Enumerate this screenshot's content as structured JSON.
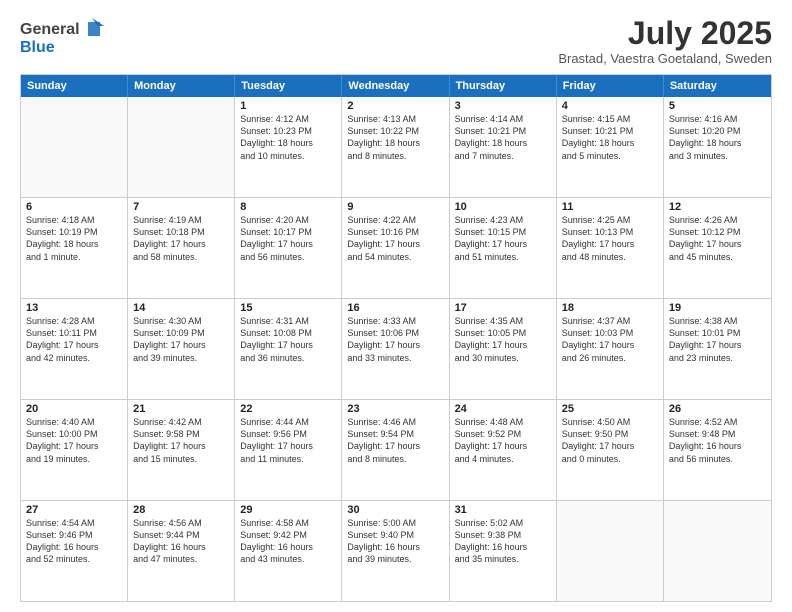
{
  "header": {
    "logo_general": "General",
    "logo_blue": "Blue",
    "month_title": "July 2025",
    "location": "Brastad, Vaestra Goetaland, Sweden"
  },
  "days_of_week": [
    "Sunday",
    "Monday",
    "Tuesday",
    "Wednesday",
    "Thursday",
    "Friday",
    "Saturday"
  ],
  "weeks": [
    [
      {
        "day": "",
        "empty": true
      },
      {
        "day": "",
        "empty": true
      },
      {
        "day": "1",
        "line1": "Sunrise: 4:12 AM",
        "line2": "Sunset: 10:23 PM",
        "line3": "Daylight: 18 hours",
        "line4": "and 10 minutes."
      },
      {
        "day": "2",
        "line1": "Sunrise: 4:13 AM",
        "line2": "Sunset: 10:22 PM",
        "line3": "Daylight: 18 hours",
        "line4": "and 8 minutes."
      },
      {
        "day": "3",
        "line1": "Sunrise: 4:14 AM",
        "line2": "Sunset: 10:21 PM",
        "line3": "Daylight: 18 hours",
        "line4": "and 7 minutes."
      },
      {
        "day": "4",
        "line1": "Sunrise: 4:15 AM",
        "line2": "Sunset: 10:21 PM",
        "line3": "Daylight: 18 hours",
        "line4": "and 5 minutes."
      },
      {
        "day": "5",
        "line1": "Sunrise: 4:16 AM",
        "line2": "Sunset: 10:20 PM",
        "line3": "Daylight: 18 hours",
        "line4": "and 3 minutes."
      }
    ],
    [
      {
        "day": "6",
        "line1": "Sunrise: 4:18 AM",
        "line2": "Sunset: 10:19 PM",
        "line3": "Daylight: 18 hours",
        "line4": "and 1 minute."
      },
      {
        "day": "7",
        "line1": "Sunrise: 4:19 AM",
        "line2": "Sunset: 10:18 PM",
        "line3": "Daylight: 17 hours",
        "line4": "and 58 minutes."
      },
      {
        "day": "8",
        "line1": "Sunrise: 4:20 AM",
        "line2": "Sunset: 10:17 PM",
        "line3": "Daylight: 17 hours",
        "line4": "and 56 minutes."
      },
      {
        "day": "9",
        "line1": "Sunrise: 4:22 AM",
        "line2": "Sunset: 10:16 PM",
        "line3": "Daylight: 17 hours",
        "line4": "and 54 minutes."
      },
      {
        "day": "10",
        "line1": "Sunrise: 4:23 AM",
        "line2": "Sunset: 10:15 PM",
        "line3": "Daylight: 17 hours",
        "line4": "and 51 minutes."
      },
      {
        "day": "11",
        "line1": "Sunrise: 4:25 AM",
        "line2": "Sunset: 10:13 PM",
        "line3": "Daylight: 17 hours",
        "line4": "and 48 minutes."
      },
      {
        "day": "12",
        "line1": "Sunrise: 4:26 AM",
        "line2": "Sunset: 10:12 PM",
        "line3": "Daylight: 17 hours",
        "line4": "and 45 minutes."
      }
    ],
    [
      {
        "day": "13",
        "line1": "Sunrise: 4:28 AM",
        "line2": "Sunset: 10:11 PM",
        "line3": "Daylight: 17 hours",
        "line4": "and 42 minutes."
      },
      {
        "day": "14",
        "line1": "Sunrise: 4:30 AM",
        "line2": "Sunset: 10:09 PM",
        "line3": "Daylight: 17 hours",
        "line4": "and 39 minutes."
      },
      {
        "day": "15",
        "line1": "Sunrise: 4:31 AM",
        "line2": "Sunset: 10:08 PM",
        "line3": "Daylight: 17 hours",
        "line4": "and 36 minutes."
      },
      {
        "day": "16",
        "line1": "Sunrise: 4:33 AM",
        "line2": "Sunset: 10:06 PM",
        "line3": "Daylight: 17 hours",
        "line4": "and 33 minutes."
      },
      {
        "day": "17",
        "line1": "Sunrise: 4:35 AM",
        "line2": "Sunset: 10:05 PM",
        "line3": "Daylight: 17 hours",
        "line4": "and 30 minutes."
      },
      {
        "day": "18",
        "line1": "Sunrise: 4:37 AM",
        "line2": "Sunset: 10:03 PM",
        "line3": "Daylight: 17 hours",
        "line4": "and 26 minutes."
      },
      {
        "day": "19",
        "line1": "Sunrise: 4:38 AM",
        "line2": "Sunset: 10:01 PM",
        "line3": "Daylight: 17 hours",
        "line4": "and 23 minutes."
      }
    ],
    [
      {
        "day": "20",
        "line1": "Sunrise: 4:40 AM",
        "line2": "Sunset: 10:00 PM",
        "line3": "Daylight: 17 hours",
        "line4": "and 19 minutes."
      },
      {
        "day": "21",
        "line1": "Sunrise: 4:42 AM",
        "line2": "Sunset: 9:58 PM",
        "line3": "Daylight: 17 hours",
        "line4": "and 15 minutes."
      },
      {
        "day": "22",
        "line1": "Sunrise: 4:44 AM",
        "line2": "Sunset: 9:56 PM",
        "line3": "Daylight: 17 hours",
        "line4": "and 11 minutes."
      },
      {
        "day": "23",
        "line1": "Sunrise: 4:46 AM",
        "line2": "Sunset: 9:54 PM",
        "line3": "Daylight: 17 hours",
        "line4": "and 8 minutes."
      },
      {
        "day": "24",
        "line1": "Sunrise: 4:48 AM",
        "line2": "Sunset: 9:52 PM",
        "line3": "Daylight: 17 hours",
        "line4": "and 4 minutes."
      },
      {
        "day": "25",
        "line1": "Sunrise: 4:50 AM",
        "line2": "Sunset: 9:50 PM",
        "line3": "Daylight: 17 hours",
        "line4": "and 0 minutes."
      },
      {
        "day": "26",
        "line1": "Sunrise: 4:52 AM",
        "line2": "Sunset: 9:48 PM",
        "line3": "Daylight: 16 hours",
        "line4": "and 56 minutes."
      }
    ],
    [
      {
        "day": "27",
        "line1": "Sunrise: 4:54 AM",
        "line2": "Sunset: 9:46 PM",
        "line3": "Daylight: 16 hours",
        "line4": "and 52 minutes."
      },
      {
        "day": "28",
        "line1": "Sunrise: 4:56 AM",
        "line2": "Sunset: 9:44 PM",
        "line3": "Daylight: 16 hours",
        "line4": "and 47 minutes."
      },
      {
        "day": "29",
        "line1": "Sunrise: 4:58 AM",
        "line2": "Sunset: 9:42 PM",
        "line3": "Daylight: 16 hours",
        "line4": "and 43 minutes."
      },
      {
        "day": "30",
        "line1": "Sunrise: 5:00 AM",
        "line2": "Sunset: 9:40 PM",
        "line3": "Daylight: 16 hours",
        "line4": "and 39 minutes."
      },
      {
        "day": "31",
        "line1": "Sunrise: 5:02 AM",
        "line2": "Sunset: 9:38 PM",
        "line3": "Daylight: 16 hours",
        "line4": "and 35 minutes."
      },
      {
        "day": "",
        "empty": true
      },
      {
        "day": "",
        "empty": true
      }
    ]
  ]
}
